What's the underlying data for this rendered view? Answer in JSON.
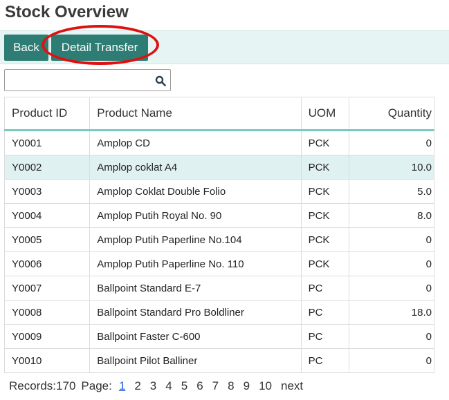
{
  "page": {
    "title": "Stock Overview"
  },
  "toolbar": {
    "back_label": "Back",
    "detail_transfer_label": "Detail Transfer"
  },
  "search": {
    "value": "",
    "placeholder": "",
    "icon": "search-icon"
  },
  "table": {
    "headers": {
      "product_id": "Product ID",
      "product_name": "Product Name",
      "uom": "UOM",
      "quantity": "Quantity"
    },
    "rows": [
      {
        "product_id": "Y0001",
        "product_name": "Amplop CD",
        "uom": "PCK",
        "quantity": "0"
      },
      {
        "product_id": "Y0002",
        "product_name": "Amplop coklat A4",
        "uom": "PCK",
        "quantity": "10.0"
      },
      {
        "product_id": "Y0003",
        "product_name": "Amplop Coklat Double Folio",
        "uom": "PCK",
        "quantity": "5.0"
      },
      {
        "product_id": "Y0004",
        "product_name": "Amplop Putih Royal No. 90",
        "uom": "PCK",
        "quantity": "8.0"
      },
      {
        "product_id": "Y0005",
        "product_name": "Amplop Putih Paperline No.104",
        "uom": "PCK",
        "quantity": "0"
      },
      {
        "product_id": "Y0006",
        "product_name": "Amplop Putih Paperline No. 110",
        "uom": "PCK",
        "quantity": "0"
      },
      {
        "product_id": "Y0007",
        "product_name": "Ballpoint Standard E-7",
        "uom": "PC",
        "quantity": "0"
      },
      {
        "product_id": "Y0008",
        "product_name": "Ballpoint Standard Pro Boldliner",
        "uom": "PC",
        "quantity": "18.0"
      },
      {
        "product_id": "Y0009",
        "product_name": "Ballpoint Faster C-600",
        "uom": "PC",
        "quantity": "0"
      },
      {
        "product_id": "Y0010",
        "product_name": "Ballpoint Pilot Balliner",
        "uom": "PC",
        "quantity": "0"
      }
    ]
  },
  "pager": {
    "records_label": "Records:",
    "records_count": "170",
    "page_label": "Page:",
    "pages": [
      "1",
      "2",
      "3",
      "4",
      "5",
      "6",
      "7",
      "8",
      "9",
      "10"
    ],
    "current_page": "1",
    "next_label": "next"
  },
  "colors": {
    "accent": "#2e7d74",
    "toolbar_bg": "#e6f5f4",
    "selected_row": "#dff1f0",
    "header_rule": "#79c9c2",
    "annotation": "#e01010"
  }
}
